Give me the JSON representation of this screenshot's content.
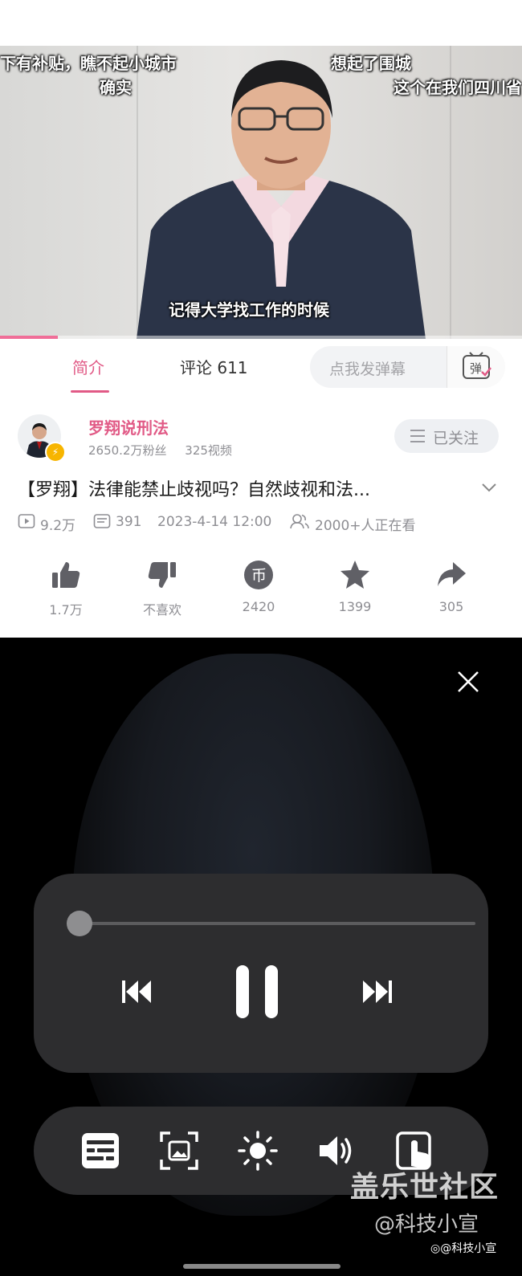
{
  "video": {
    "subtitles": {
      "top_left": "下有补贴，瞧不起小城市",
      "top_left_2": "确实",
      "top_right": "想起了围城",
      "top_right_2": "这个在我们四川省",
      "bottom": "记得大学找工作的时候"
    },
    "progress_fraction": 0.11
  },
  "tabs": {
    "intro": "简介",
    "comments": "评论 611",
    "danmu_placeholder": "点我发弹幕",
    "danmu_icon_label": "弹"
  },
  "uploader": {
    "name": "罗翔说刑法",
    "fans": "2650.2万粉丝",
    "videos": "325视频",
    "follow_label": "已关注"
  },
  "video_info": {
    "title": "【罗翔】法律能禁止歧视吗？自然歧视和法...",
    "plays": "9.2万",
    "danmaku_count": "391",
    "date": "2023-4-14 12:00",
    "watching": "2000+人正在看"
  },
  "actions": [
    {
      "icon": "thumb-up-icon",
      "label": "1.7万"
    },
    {
      "icon": "thumb-down-icon",
      "label": "不喜欢"
    },
    {
      "icon": "coin-icon",
      "label": "2420",
      "glyph": "币"
    },
    {
      "icon": "star-icon",
      "label": "1399"
    },
    {
      "icon": "share-icon",
      "label": "305"
    }
  ],
  "player_controls": {
    "playback_fraction": 0.0,
    "buttons": [
      "previous-icon",
      "pause-icon",
      "next-icon"
    ],
    "tools": [
      "subtitle-icon",
      "screenshot-icon",
      "brightness-icon",
      "volume-icon",
      "touch-lock-icon"
    ]
  },
  "watermark": {
    "site": "盖乐世社区",
    "author": "@科技小宣",
    "weibo": "@科技小宣"
  },
  "colors": {
    "accent": "#e15a86",
    "panel": "#2d2d2f",
    "badge": "#f7b500"
  }
}
